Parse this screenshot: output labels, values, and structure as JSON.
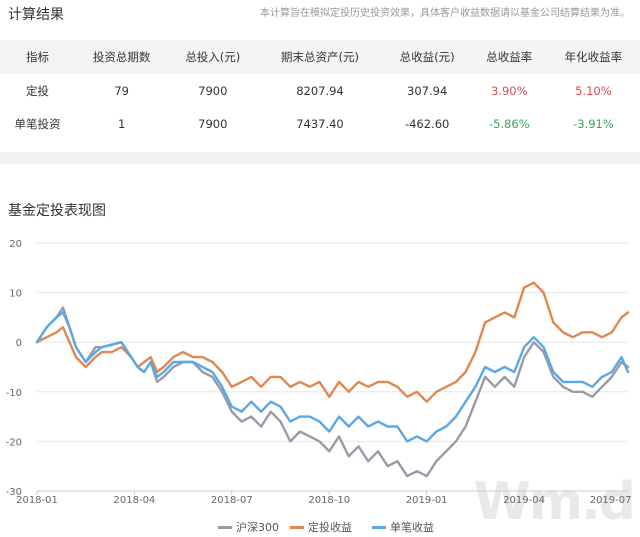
{
  "header": {
    "title": "计算结果",
    "disclaimer": "本计算旨在模拟定投历史投资效果，具体客户收益数据请以基金公司结算结果为准。"
  },
  "table": {
    "columns": [
      "指标",
      "投资总期数",
      "总投入(元)",
      "期末总资产(元)",
      "总收益(元)",
      "总收益率",
      "年化收益率"
    ],
    "rows": [
      {
        "cells": [
          "定投",
          "79",
          "7900",
          "8207.94",
          "307.94",
          "3.90%",
          "5.10%"
        ]
      },
      {
        "cells": [
          "单笔投资",
          "1",
          "7900",
          "7437.40",
          "-462.60",
          "-5.86%",
          "-3.91%"
        ]
      }
    ]
  },
  "chart_section": {
    "title": "基金定投表现图"
  },
  "watermark": "Wm.d",
  "colors": {
    "hs300": "#9a9aa8",
    "dingtou": "#e08850",
    "danbi": "#5aa9e6",
    "positive": "#e04b4b",
    "negative": "#3aa35c"
  },
  "chart_data": {
    "type": "line",
    "ylim": [
      -30,
      20
    ],
    "yticks": [
      "20",
      "10",
      "0",
      "-10",
      "-20",
      "-30"
    ],
    "xlim": [
      0,
      18.2
    ],
    "xticks": [
      {
        "label": "2018-01",
        "x": 0
      },
      {
        "label": "2018-04",
        "x": 3
      },
      {
        "label": "2018-07",
        "x": 6
      },
      {
        "label": "2018-10",
        "x": 9
      },
      {
        "label": "2019-01",
        "x": 12
      },
      {
        "label": "2019-04",
        "x": 15
      },
      {
        "label": "2019-07",
        "x": 18
      }
    ],
    "series": [
      {
        "name": "沪深300",
        "color": "#9a9aa8",
        "x": [
          0,
          0.3,
          0.6,
          0.8,
          1.0,
          1.2,
          1.5,
          1.8,
          2.0,
          2.3,
          2.6,
          2.9,
          3.1,
          3.3,
          3.5,
          3.7,
          3.9,
          4.2,
          4.5,
          4.8,
          5.1,
          5.4,
          5.7,
          6.0,
          6.3,
          6.6,
          6.9,
          7.2,
          7.5,
          7.8,
          8.1,
          8.4,
          8.7,
          9.0,
          9.3,
          9.6,
          9.9,
          10.2,
          10.5,
          10.8,
          11.1,
          11.4,
          11.7,
          12.0,
          12.3,
          12.6,
          12.9,
          13.2,
          13.5,
          13.8,
          14.1,
          14.4,
          14.7,
          15.0,
          15.3,
          15.6,
          15.9,
          16.2,
          16.5,
          16.8,
          17.1,
          17.4,
          17.7,
          18.0,
          18.2
        ],
        "y": [
          0,
          3,
          5,
          7,
          3,
          -1,
          -4,
          -1,
          -1,
          -0.5,
          0,
          -3,
          -5,
          -6,
          -4,
          -8,
          -7,
          -5,
          -4,
          -4,
          -6,
          -7,
          -10,
          -14,
          -16,
          -15,
          -17,
          -14,
          -16,
          -20,
          -18,
          -19,
          -20,
          -22,
          -19,
          -23,
          -21,
          -24,
          -22,
          -25,
          -24,
          -27,
          -26,
          -27,
          -24,
          -22,
          -20,
          -17,
          -12,
          -7,
          -9,
          -7,
          -9,
          -3,
          0,
          -2,
          -7,
          -9,
          -10,
          -10,
          -11,
          -9,
          -7,
          -4,
          -5
        ]
      },
      {
        "name": "定投收益",
        "color": "#e08850",
        "x": [
          0,
          0.3,
          0.6,
          0.8,
          1.0,
          1.2,
          1.5,
          1.8,
          2.0,
          2.3,
          2.6,
          2.9,
          3.1,
          3.3,
          3.5,
          3.7,
          3.9,
          4.2,
          4.5,
          4.8,
          5.1,
          5.4,
          5.7,
          6.0,
          6.3,
          6.6,
          6.9,
          7.2,
          7.5,
          7.8,
          8.1,
          8.4,
          8.7,
          9.0,
          9.3,
          9.6,
          9.9,
          10.2,
          10.5,
          10.8,
          11.1,
          11.4,
          11.7,
          12.0,
          12.3,
          12.6,
          12.9,
          13.2,
          13.5,
          13.8,
          14.1,
          14.4,
          14.7,
          15.0,
          15.3,
          15.6,
          15.9,
          16.2,
          16.5,
          16.8,
          17.1,
          17.4,
          17.7,
          18.0,
          18.2
        ],
        "y": [
          0,
          1,
          2,
          3,
          0,
          -3,
          -5,
          -3,
          -2,
          -2,
          -1,
          -3,
          -5,
          -4,
          -3,
          -6,
          -5,
          -3,
          -2,
          -3,
          -3,
          -4,
          -6,
          -9,
          -8,
          -7,
          -9,
          -7,
          -7,
          -9,
          -8,
          -9,
          -8,
          -11,
          -8,
          -10,
          -8,
          -9,
          -8,
          -8,
          -9,
          -11,
          -10,
          -12,
          -10,
          -9,
          -8,
          -6,
          -2,
          4,
          5,
          6,
          5,
          11,
          12,
          10,
          4,
          2,
          1,
          2,
          2,
          1,
          2,
          5,
          6
        ]
      },
      {
        "name": "单笔收益",
        "color": "#5aa9e6",
        "x": [
          0,
          0.3,
          0.6,
          0.8,
          1.0,
          1.2,
          1.5,
          1.8,
          2.0,
          2.3,
          2.6,
          2.9,
          3.1,
          3.3,
          3.5,
          3.7,
          3.9,
          4.2,
          4.5,
          4.8,
          5.1,
          5.4,
          5.7,
          6.0,
          6.3,
          6.6,
          6.9,
          7.2,
          7.5,
          7.8,
          8.1,
          8.4,
          8.7,
          9.0,
          9.3,
          9.6,
          9.9,
          10.2,
          10.5,
          10.8,
          11.1,
          11.4,
          11.7,
          12.0,
          12.3,
          12.6,
          12.9,
          13.2,
          13.5,
          13.8,
          14.1,
          14.4,
          14.7,
          15.0,
          15.3,
          15.6,
          15.9,
          16.2,
          16.5,
          16.8,
          17.1,
          17.4,
          17.7,
          18.0,
          18.2
        ],
        "y": [
          0,
          3,
          5,
          6,
          3,
          -1,
          -4,
          -2,
          -1,
          -0.5,
          0,
          -3,
          -5,
          -6,
          -4,
          -7,
          -6,
          -4,
          -4,
          -4,
          -5,
          -6,
          -9,
          -13,
          -14,
          -12,
          -14,
          -12,
          -13,
          -16,
          -15,
          -15,
          -16,
          -18,
          -15,
          -17,
          -15,
          -17,
          -16,
          -17,
          -17,
          -20,
          -19,
          -20,
          -18,
          -17,
          -15,
          -12,
          -9,
          -5,
          -6,
          -5,
          -6,
          -1,
          1,
          -1,
          -6,
          -8,
          -8,
          -8,
          -9,
          -7,
          -6,
          -3,
          -6
        ]
      }
    ]
  }
}
